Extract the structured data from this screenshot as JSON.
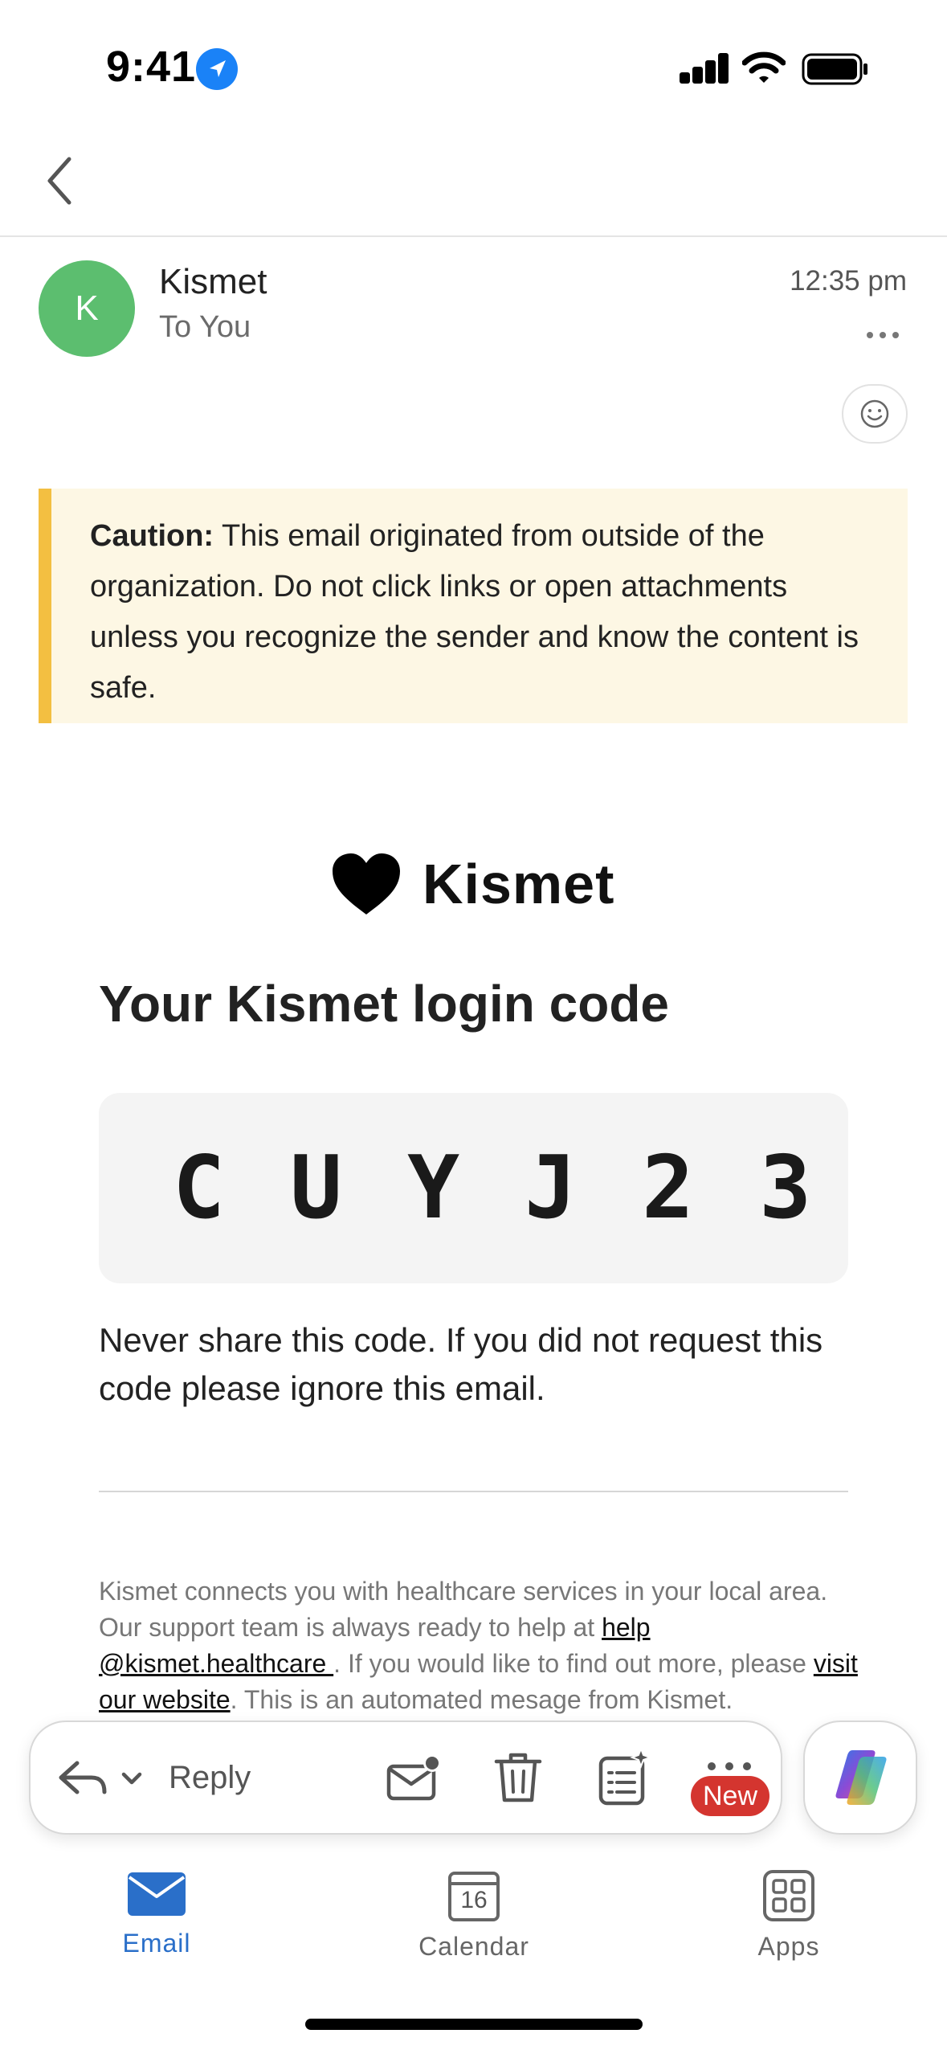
{
  "status_bar": {
    "time": "9:41"
  },
  "message": {
    "avatar_initial": "K",
    "sender": "Kismet",
    "recipient": "To You",
    "time": "12:35 pm"
  },
  "caution": {
    "label": "Caution:",
    "text": " This email originated from outside of the organization. Do not click links or open attachments unless you recognize the sender and know the content is safe."
  },
  "email": {
    "brand_name": "Kismet",
    "heading": "Your Kismet login code",
    "code": "C U Y J 2 3",
    "warning": "Never share this code. If you did not request this code please ignore this email.",
    "footer_text_1": "Kismet connects you with healthcare services in your local area. Our support team is always ready to help at ",
    "footer_link_1": "help @kismet.healthcare ",
    "footer_text_2": ". If you would like to find out more, please ",
    "footer_link_2": "visit our website",
    "footer_text_3": ". This is an automated mesage from Kismet."
  },
  "actions": {
    "reply_label": "Reply",
    "new_badge": "New",
    "icons": [
      "reply-icon",
      "chevron-down-icon",
      "mark-unread-icon",
      "trash-icon",
      "summarize-icon",
      "more-icon",
      "copilot-icon"
    ]
  },
  "tabs": [
    {
      "label": "Email",
      "active": true,
      "color": "#2a6fc9"
    },
    {
      "label": "Calendar",
      "active": false,
      "calendar_day": "16"
    },
    {
      "label": "Apps",
      "active": false
    }
  ],
  "colors": {
    "accent": "#2a6fc9",
    "avatar": "#5cbe6f",
    "caution_bar": "#f3bf41",
    "caution_bg": "#fdf7e4",
    "badge": "#d4352f"
  }
}
